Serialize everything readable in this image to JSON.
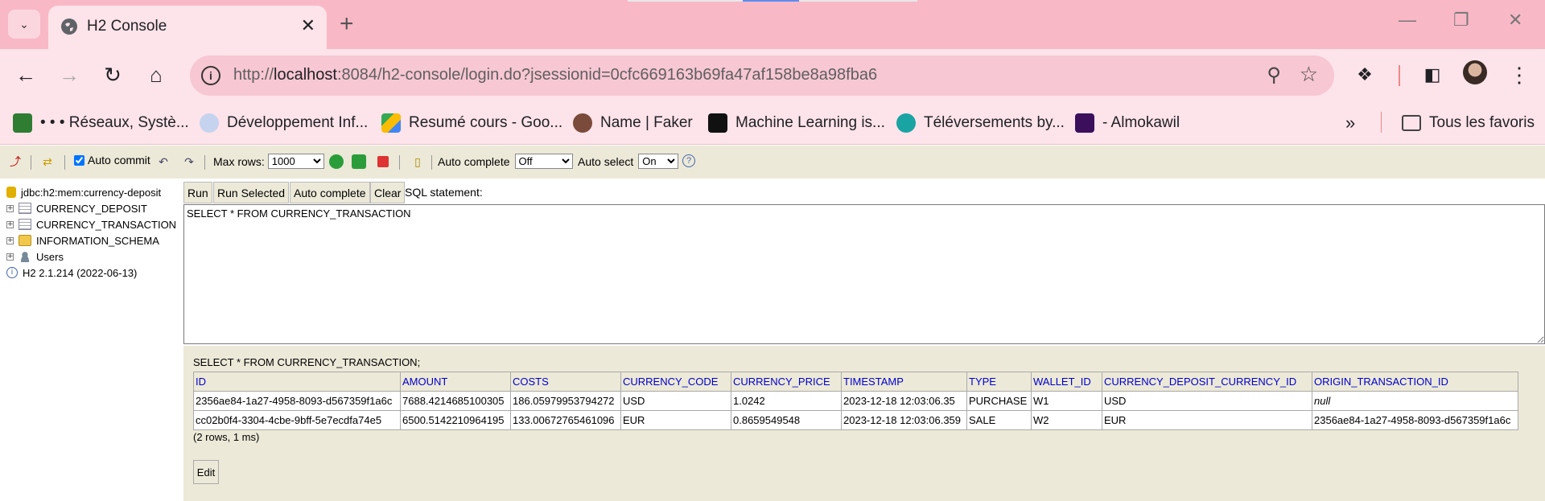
{
  "browser": {
    "tab_title": "H2 Console",
    "url_prefix": "http://",
    "url_host": "localhost",
    "url_rest": ":8084/h2-console/login.do?jsessionid=0cfc669163b69fa47af158be8a98fba6",
    "bookmarks": [
      {
        "label": "• • • Réseaux, Systè...",
        "color": "#2e7d32"
      },
      {
        "label": "Développement Inf...",
        "color": "#8aa4d6"
      },
      {
        "label": "Resumé cours - Goo...",
        "color": "#34a853"
      },
      {
        "label": "Name | Faker",
        "color": "#7a4a3a"
      },
      {
        "label": "Machine Learning is...",
        "color": "#111111"
      },
      {
        "label": "Téléversements by...",
        "color": "#1aa3a3"
      },
      {
        "label": "- Almokawil",
        "color": "#3b0f5c"
      }
    ],
    "all_bookmarks": "Tous les favoris"
  },
  "toolbar": {
    "auto_commit_label": "Auto commit",
    "max_rows_label": "Max rows:",
    "max_rows_value": "1000",
    "auto_complete_label": "Auto complete",
    "auto_complete_value": "Off",
    "auto_select_label": "Auto select",
    "auto_select_value": "On"
  },
  "sidebar": {
    "connection": "jdbc:h2:mem:currency-deposit",
    "items": [
      {
        "label": "CURRENCY_DEPOSIT",
        "icon": "table-icon"
      },
      {
        "label": "CURRENCY_TRANSACTION",
        "icon": "table-icon"
      },
      {
        "label": "INFORMATION_SCHEMA",
        "icon": "folder-icon"
      },
      {
        "label": "Users",
        "icon": "users-icon"
      }
    ],
    "version": "H2 2.1.214 (2022-06-13)"
  },
  "query": {
    "run": "Run",
    "run_selected": "Run Selected",
    "auto_complete": "Auto complete",
    "clear": "Clear",
    "sql_statement_label": "SQL statement:",
    "sql": "SELECT * FROM CURRENCY_TRANSACTION"
  },
  "results": {
    "statement": "SELECT * FROM CURRENCY_TRANSACTION;",
    "columns": [
      "ID",
      "AMOUNT",
      "COSTS",
      "CURRENCY_CODE",
      "CURRENCY_PRICE",
      "TIMESTAMP",
      "TYPE",
      "WALLET_ID",
      "CURRENCY_DEPOSIT_CURRENCY_ID",
      "ORIGIN_TRANSACTION_ID"
    ],
    "rows": [
      [
        "2356ae84-1a27-4958-8093-d567359f1a6c",
        "7688.4214685100305",
        "186.05979953794272",
        "USD",
        "1.0242",
        "2023-12-18 12:03:06.35",
        "PURCHASE",
        "W1",
        "USD",
        "null"
      ],
      [
        "cc02b0f4-3304-4cbe-9bff-5e7ecdfa74e5",
        "6500.5142210964195",
        "133.00672765461096",
        "EUR",
        "0.8659549548",
        "2023-12-18 12:03:06.359",
        "SALE",
        "W2",
        "EUR",
        "2356ae84-1a27-4958-8093-d567359f1a6c"
      ]
    ],
    "row_count": "(2 rows, 1 ms)",
    "edit": "Edit"
  }
}
